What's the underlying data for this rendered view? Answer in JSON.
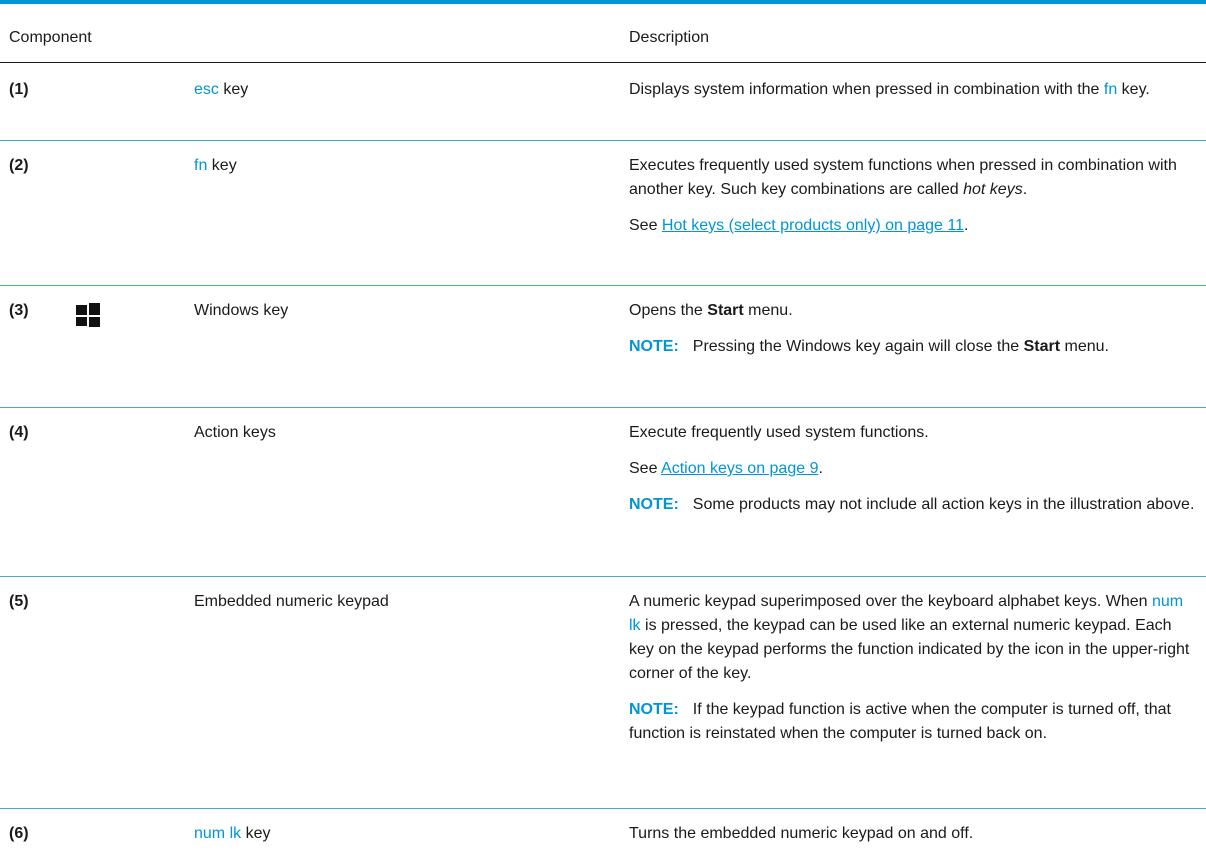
{
  "header": {
    "component": "Component",
    "description": "Description"
  },
  "rows": [
    {
      "num": "(1)",
      "name_key": "esc",
      "name_suffix": " key",
      "desc": {
        "p1_a": "Displays system information when pressed in combination with the ",
        "p1_key": "fn",
        "p1_b": " key."
      }
    },
    {
      "num": "(2)",
      "name_key": "fn",
      "name_suffix": " key",
      "desc": {
        "p1_a": "Executes frequently used system functions when pressed in combination with another key. Such key combinations are called ",
        "p1_em": "hot keys",
        "p1_b": ".",
        "p2_a": "See ",
        "p2_link": "Hot keys (select products only) on page 11",
        "p2_b": "."
      }
    },
    {
      "num": "(3)",
      "icon": "windows-logo-icon",
      "name": "Windows key",
      "desc": {
        "p1_a": "Opens the ",
        "p1_strong": "Start",
        "p1_b": " menu.",
        "note_label": "NOTE:",
        "note_a": "Pressing the Windows key again will close the ",
        "note_strong": "Start",
        "note_b": " menu."
      }
    },
    {
      "num": "(4)",
      "name": "Action keys",
      "desc": {
        "p1": "Execute frequently used system functions.",
        "p2_a": "See ",
        "p2_link": "Action keys on page 9",
        "p2_b": ".",
        "note_label": "NOTE:",
        "note": "Some products may not include all action keys in the illustration above."
      }
    },
    {
      "num": "(5)",
      "name": "Embedded numeric keypad",
      "desc": {
        "p1_a": "A numeric keypad superimposed over the keyboard alphabet keys. When ",
        "p1_key": "num lk",
        "p1_b": " is pressed, the keypad can be used like an external numeric keypad. Each key on the keypad performs the function indicated by the icon in the upper-right corner of the key.",
        "note_label": "NOTE:",
        "note": "If the keypad function is active when the computer is turned off, that function is reinstated when the computer is turned back on."
      }
    },
    {
      "num": "(6)",
      "name_key": "num lk",
      "name_suffix": " key",
      "desc": {
        "p1": "Turns the embedded numeric keypad on and off."
      }
    }
  ],
  "colors": {
    "accent": "#0096d6",
    "rule": "#4aa7d8",
    "text": "#1a1a1a"
  }
}
